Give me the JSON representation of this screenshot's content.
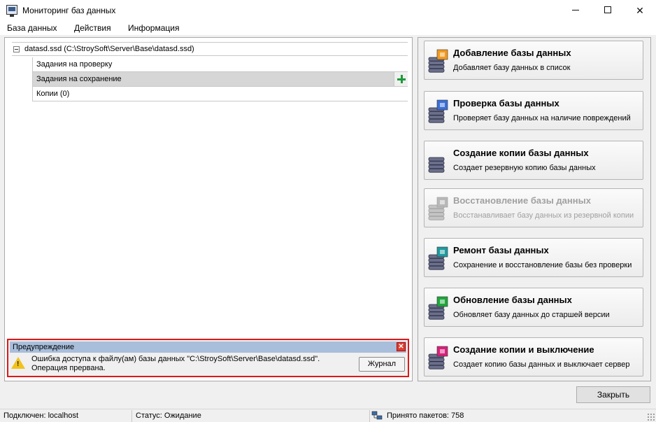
{
  "window": {
    "title": "Мониторинг баз данных",
    "icon": "monitor-icon"
  },
  "menu": [
    "База данных",
    "Действия",
    "Информация"
  ],
  "tree": {
    "root_label": "datasd.ssd (C:\\StroySoft\\Server\\Base\\datasd.ssd)",
    "children": [
      {
        "label": "Задания на проверку",
        "selected": false
      },
      {
        "label": "Задания на сохранение",
        "selected": true
      },
      {
        "label": "Копии (0)",
        "selected": false
      }
    ]
  },
  "warning": {
    "header": "Предупреждение",
    "message": "Ошибка доступа к файлу(ам) базы данных \"C:\\StroySoft\\Server\\Base\\datasd.ssd\". Операция прервана.",
    "journal_button": "Журнал"
  },
  "actions": [
    {
      "title": "Добавление базы данных",
      "description": "Добавляет базу данных в список",
      "icon": "db-add-icon",
      "badge": "#f39a1e",
      "enabled": true
    },
    {
      "title": "Проверка базы данных",
      "description": "Проверяет базу данных на наличие повреждений",
      "icon": "db-check-icon",
      "badge": "#3b6fd8",
      "enabled": true
    },
    {
      "title": "Создание копии базы данных",
      "description": "Создает резервную копию базы данных",
      "icon": "db-copy-icon",
      "badge": "",
      "enabled": true
    },
    {
      "title": "Восстановление базы данных",
      "description": "Восстанавливает базу данных из резервной копии",
      "icon": "db-restore-icon",
      "badge": "#b8b8b8",
      "enabled": false
    },
    {
      "title": "Ремонт базы данных",
      "description": "Сохранение и восстановление базы без проверки",
      "icon": "db-repair-icon",
      "badge": "#1e9aa0",
      "enabled": true
    },
    {
      "title": "Обновление базы данных",
      "description": "Обновляет базу данных до старшей версии",
      "icon": "db-update-icon",
      "badge": "#1ea83c",
      "enabled": true
    },
    {
      "title": "Создание копии и выключение",
      "description": "Создает копию базы данных и выключает сервер",
      "icon": "db-shutdown-icon",
      "badge": "#d8217a",
      "enabled": true
    }
  ],
  "close_button": "Закрыть",
  "status": {
    "connected": "Подключен: localhost",
    "state": "Статус: Ожидание",
    "packets": "Принято пакетов: 758"
  }
}
